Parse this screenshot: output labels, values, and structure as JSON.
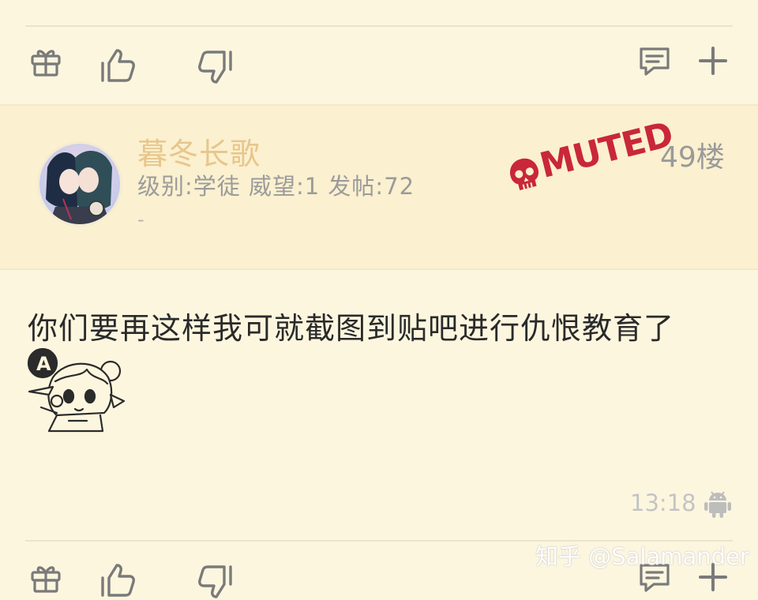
{
  "top_action_bar": {
    "gift_icon": "gift-icon",
    "like_icon": "thumbs-up-icon",
    "dislike_icon": "thumbs-down-icon",
    "comment_icon": "comment-icon",
    "more_icon": "plus-icon"
  },
  "post": {
    "username": "暮冬长歌",
    "user_meta": "级别:学徒 威望:1 发帖:72",
    "user_meta_dash": "-",
    "stamp_text": "MUTED",
    "floor": "49楼",
    "content": "你们要再这样我可就截图到贴吧进行仇恨教育了",
    "time": "13:18",
    "platform_icon": "android-icon"
  },
  "watermark": "知乎 @Salamander",
  "colors": {
    "background": "#fdf6df",
    "header_background": "#fbf0cf",
    "username": "#e7c68c",
    "stamp": "#c9273a",
    "meta": "#9b9b9b"
  }
}
